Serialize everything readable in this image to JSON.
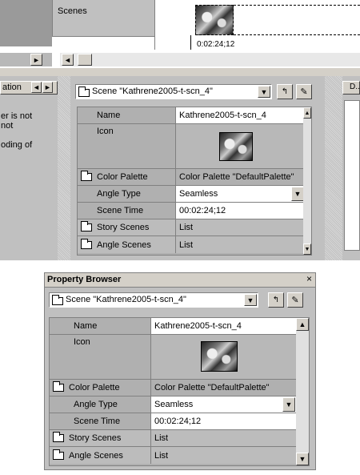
{
  "timeline": {
    "scenes_label": "Scenes",
    "timecode": "0:02:24;12",
    "arrow_left": "◄",
    "arrow_right": "►"
  },
  "left_panel": {
    "header": "ation",
    "lines": [
      "er is not",
      "not",
      "",
      "oding of"
    ]
  },
  "right_panel": {
    "header": "D..."
  },
  "docked_browser": {
    "selector_value": "Scene \"Kathrene2005-t-scn_4\"",
    "rows": {
      "name_label": "Name",
      "name_value": "Kathrene2005-t-scn_4",
      "icon_label": "Icon",
      "palette_label": "Color Palette",
      "palette_value": "Color Palette \"DefaultPalette\"",
      "angle_label": "Angle Type",
      "angle_value": "Seamless",
      "time_label": "Scene Time",
      "time_value": "00:02:24;12",
      "story_label": "Story Scenes",
      "story_value": "List",
      "angles_label": "Angle Scenes",
      "angles_value": "List"
    }
  },
  "property_browser": {
    "title": "Property Browser",
    "close": "×",
    "selector_value": "Scene \"Kathrene2005-t-scn_4\"",
    "rows": {
      "name_label": "Name",
      "name_value": "Kathrene2005-t-scn_4",
      "icon_label": "Icon",
      "palette_label": "Color Palette",
      "palette_value": "Color Palette \"DefaultPalette\"",
      "angle_label": "Angle Type",
      "angle_value": "Seamless",
      "time_label": "Scene Time",
      "time_value": "00:02:24;12",
      "story_label": "Story Scenes",
      "story_value": "List",
      "angles_label": "Angle Scenes",
      "angles_value": "List"
    }
  },
  "glyphs": {
    "down": "▼",
    "up": "▲",
    "left": "◄",
    "right": "►"
  }
}
